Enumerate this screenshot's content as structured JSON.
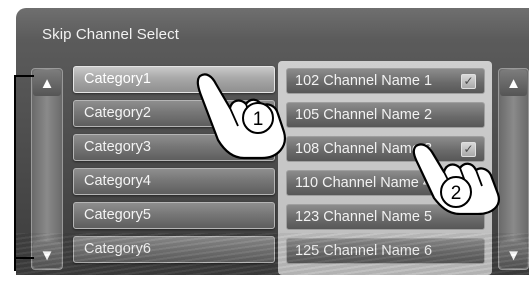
{
  "window": {
    "title": "Skip Channel Select"
  },
  "categories": [
    {
      "label": "Category1",
      "selected": true
    },
    {
      "label": "Category2",
      "selected": false
    },
    {
      "label": "Category3",
      "selected": false
    },
    {
      "label": "Category4",
      "selected": false
    },
    {
      "label": "Category5",
      "selected": false
    },
    {
      "label": "Category6",
      "selected": false
    }
  ],
  "channels": [
    {
      "label": "102 Channel Name 1",
      "checked": true
    },
    {
      "label": "105 Channel Name 2",
      "checked": false
    },
    {
      "label": "108 Channel Name 3",
      "checked": true
    },
    {
      "label": "110 Channel Name 4",
      "checked": false
    },
    {
      "label": "123 Channel Name 5",
      "checked": false
    },
    {
      "label": "125 Channel Name 6",
      "checked": false
    }
  ],
  "scroll": {
    "up_icon": "▲",
    "down_icon": "▼"
  },
  "check_icon": "✓",
  "callouts": {
    "step1": "1",
    "step2": "2"
  }
}
